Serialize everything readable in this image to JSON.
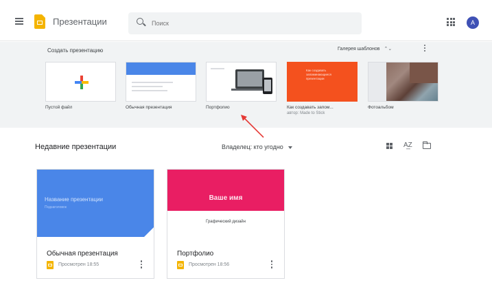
{
  "header": {
    "app_title": "Презентации",
    "search_placeholder": "Поиск",
    "avatar_letter": "A",
    "icons": [
      "menu-icon",
      "slides-logo",
      "search-icon",
      "apps-grid-icon",
      "account-avatar"
    ]
  },
  "gallery": {
    "title": "Создать презентацию",
    "toggle_label": "Галерея шаблонов",
    "toggle_arrows": "⌃⌄",
    "templates": [
      {
        "label": "Пустой файл",
        "sub": ""
      },
      {
        "label": "Обычная презентация",
        "sub": ""
      },
      {
        "label": "Портфолио",
        "sub": ""
      },
      {
        "label": "Как создавать запом...",
        "sub": "автор: Made to Stick",
        "thumb_text": "Как создавать запоминающиеся презентации"
      },
      {
        "label": "Фотоальбом",
        "sub": ""
      }
    ]
  },
  "recent": {
    "title": "Недавние презентации",
    "owner_filter": "Владелец: кто угодно",
    "view_icons": [
      "grid-view-icon",
      "sort-az-icon",
      "folder-icon"
    ],
    "sort_glyph": "A͢Z",
    "cards": [
      {
        "name": "Обычная презентация",
        "meta": "Просмотрен 18:55",
        "thumb_title": "Название презентации",
        "thumb_sub": "Подзаголовок"
      },
      {
        "name": "Портфолио",
        "meta": "Просмотрен 18:56",
        "thumb_title": "Ваше имя",
        "thumb_sub": "Графический дизайн"
      }
    ]
  },
  "colors": {
    "slides_yellow": "#f4b400",
    "blue_slide": "#4a86e8",
    "pink_slide": "#e91e63",
    "orange_template": "#f4511e",
    "annotation_arrow": "#e53935",
    "gallery_bg": "#f1f3f4"
  }
}
